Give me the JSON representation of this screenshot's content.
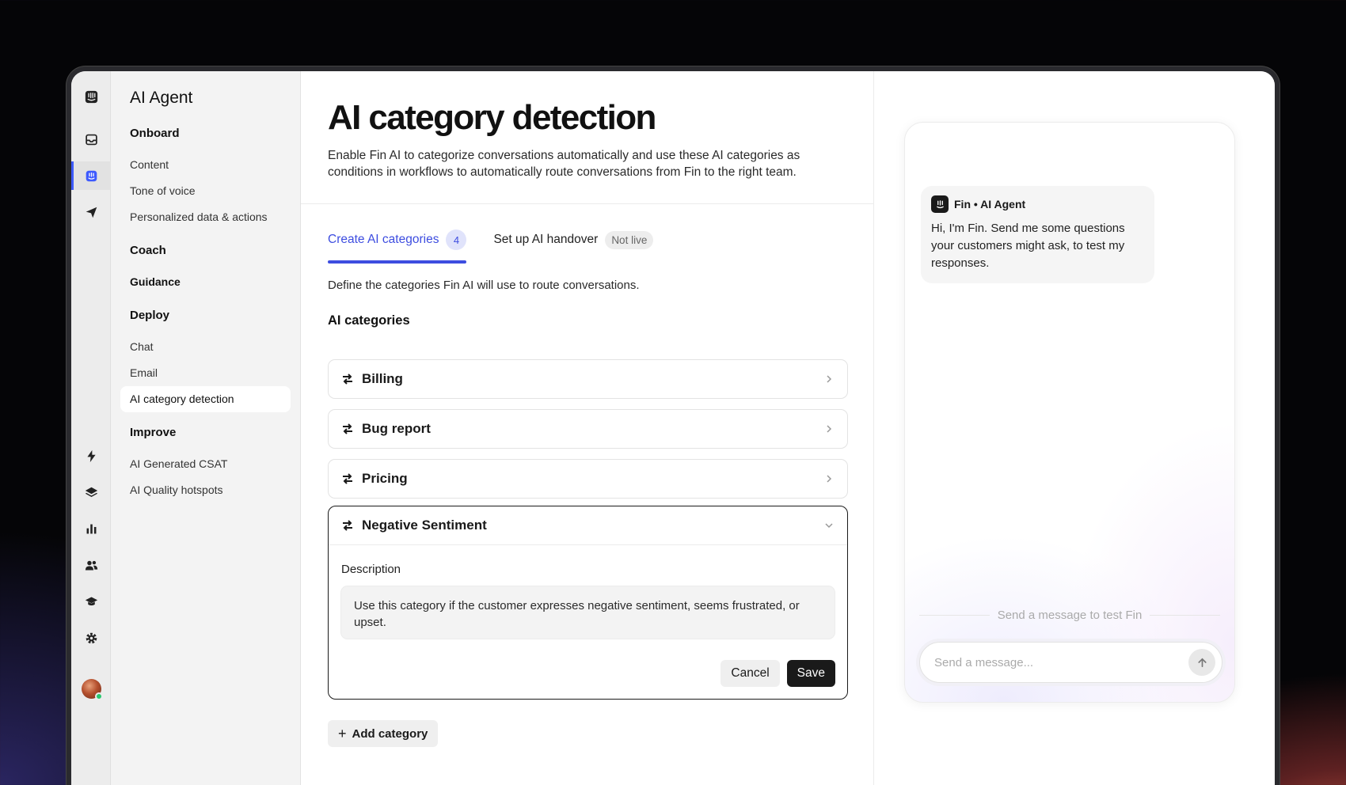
{
  "subnav": {
    "title": "AI Agent",
    "sections": [
      {
        "heading": "Onboard",
        "items": [
          "Content",
          "Tone of voice",
          "Personalized data & actions"
        ]
      },
      {
        "heading": "Coach",
        "items": [
          "Guidance"
        ]
      },
      {
        "heading": "Deploy",
        "items": [
          "Chat",
          "Email",
          "AI category detection"
        ]
      },
      {
        "heading": "Improve",
        "items": [
          "AI Generated CSAT",
          "AI Quality hotspots"
        ]
      }
    ]
  },
  "main": {
    "title": "AI category detection",
    "description": "Enable Fin AI to categorize conversations automatically and use these AI categories as conditions in workflows to automatically route conversations from Fin to the right team.",
    "tabs": [
      {
        "label": "Create AI categories",
        "badge": "4"
      },
      {
        "label": "Set up AI handover",
        "badge": "Not live"
      }
    ],
    "intro": "Define the categories Fin AI will use to route conversations.",
    "categories_heading": "AI categories",
    "categories": [
      "Billing",
      "Bug report",
      "Pricing"
    ],
    "expanded_category": {
      "name": "Negative Sentiment",
      "description_label": "Description",
      "description": "Use this category if the customer expresses negative sentiment, seems frustrated, or upset.",
      "cancel_label": "Cancel",
      "save_label": "Save"
    },
    "add_category_label": "Add category"
  },
  "preview": {
    "sender": "Fin • AI Agent",
    "message": "Hi, I'm Fin. Send me some questions your customers might ask, to test my responses.",
    "test_hint": "Send a message to test Fin",
    "input_placeholder": "Send a message..."
  },
  "colors": {
    "accent": "#3d4de0",
    "online": "#28c76f"
  }
}
